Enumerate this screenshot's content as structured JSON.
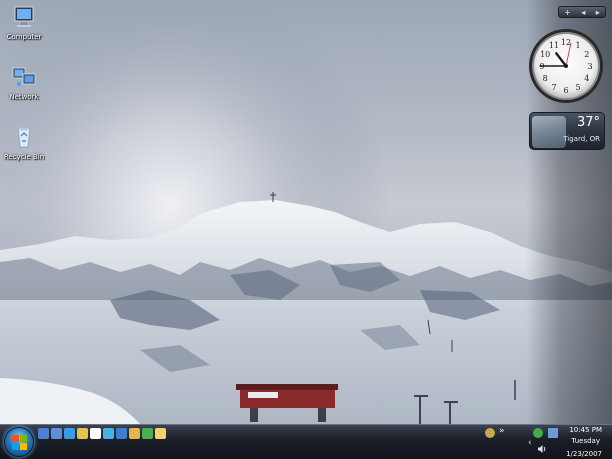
{
  "desktop": {
    "icons": [
      {
        "label": "Computer",
        "icon": "computer-icon"
      },
      {
        "label": "Network",
        "icon": "network-icon"
      },
      {
        "label": "Recycle Bin",
        "icon": "recycle-bin-icon"
      }
    ]
  },
  "sidebar": {
    "controls": [
      "+",
      "◂",
      "▸"
    ],
    "clock": {
      "hour": 10,
      "minute": 45,
      "numerals": [
        "12",
        "1",
        "2",
        "3",
        "4",
        "5",
        "6",
        "7",
        "8",
        "9",
        "10",
        "11"
      ]
    },
    "weather": {
      "temp": "37°",
      "location": "Tigard, OR"
    }
  },
  "taskbar": {
    "quicklaunch": [
      {
        "icon": "show-desktop-icon",
        "color": "#4a7fd4"
      },
      {
        "icon": "switch-windows-icon",
        "color": "#5f8fd8"
      },
      {
        "icon": "internet-explorer-icon",
        "color": "#3a9be8"
      },
      {
        "icon": "folder-icon",
        "color": "#e8c24a"
      },
      {
        "icon": "outlook-icon",
        "color": "#ffffff"
      },
      {
        "icon": "messenger-icon",
        "color": "#4ab0e8"
      },
      {
        "icon": "media-player-icon",
        "color": "#3a7fd0"
      },
      {
        "icon": "app-icon",
        "color": "#e8b54a"
      },
      {
        "icon": "chrome-icon",
        "color": "#4caf50"
      },
      {
        "icon": "note-icon",
        "color": "#f2d26a"
      }
    ],
    "tray": {
      "overflow": "»",
      "expand": "‹",
      "time": "10:45 PM",
      "day": "Tuesday",
      "date": "1/23/2007"
    }
  }
}
